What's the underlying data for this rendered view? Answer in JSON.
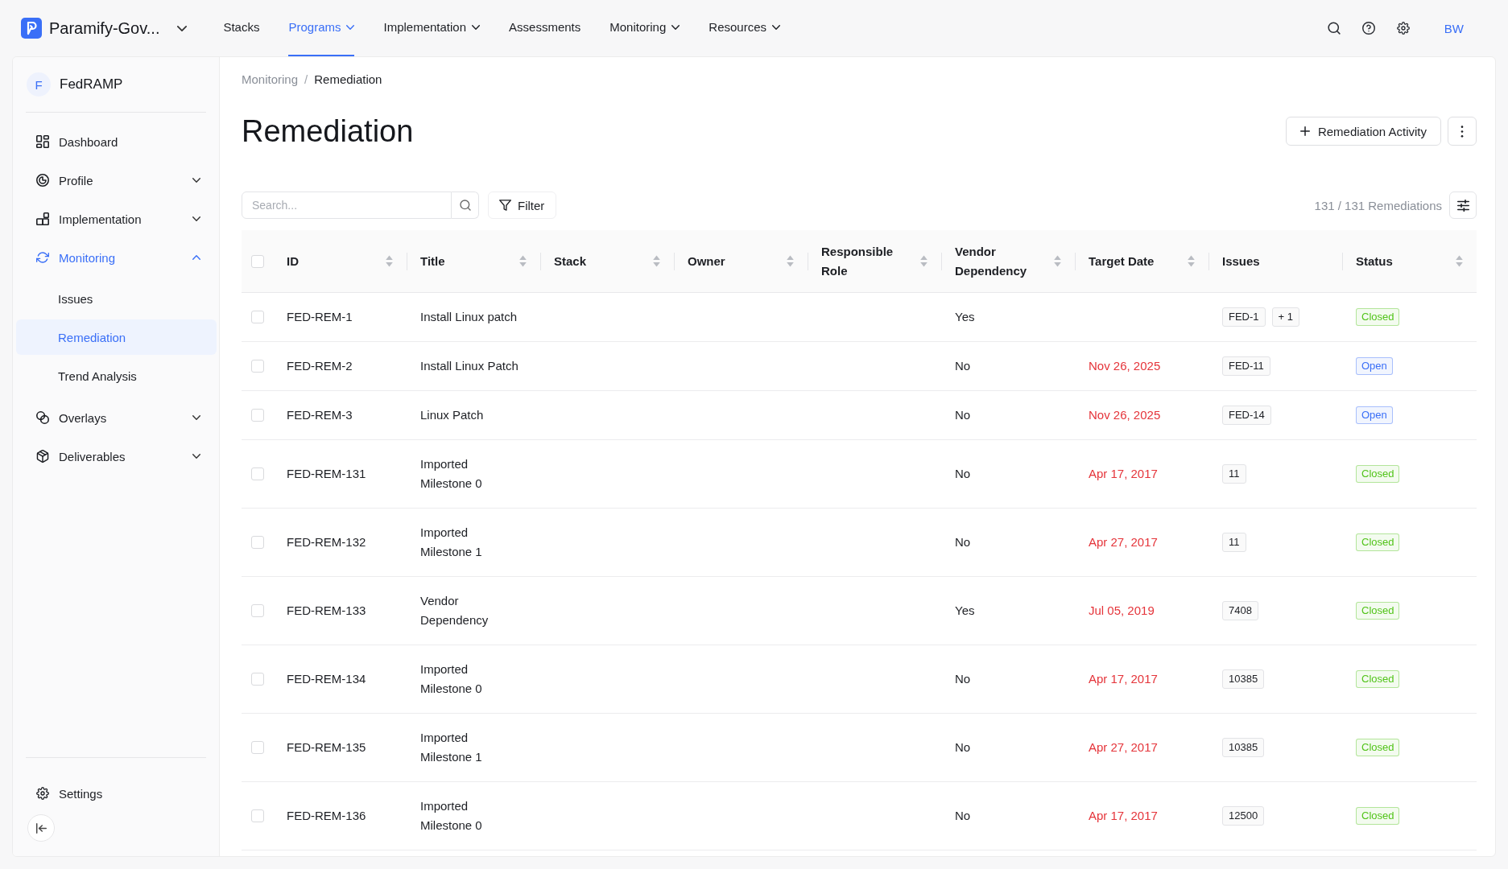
{
  "app": {
    "name": "Paramify-Gov..."
  },
  "nav": [
    {
      "label": "Stacks",
      "selected": false,
      "dropdown": false
    },
    {
      "label": "Programs",
      "selected": true,
      "dropdown": true
    },
    {
      "label": "Implementation",
      "selected": false,
      "dropdown": true
    },
    {
      "label": "Assessments",
      "selected": false,
      "dropdown": false
    },
    {
      "label": "Monitoring",
      "selected": false,
      "dropdown": true
    },
    {
      "label": "Resources",
      "selected": false,
      "dropdown": true
    }
  ],
  "user": {
    "initials": "BW"
  },
  "sidebar": {
    "program": {
      "initial": "F",
      "name": "FedRAMP"
    },
    "items": [
      {
        "label": "Dashboard",
        "kind": "link",
        "selected": false
      },
      {
        "label": "Profile",
        "kind": "group",
        "selected": false,
        "expanded": false
      },
      {
        "label": "Implementation",
        "kind": "group",
        "selected": false,
        "expanded": false
      },
      {
        "label": "Monitoring",
        "kind": "group",
        "selected": true,
        "expanded": true,
        "children": [
          {
            "label": "Issues",
            "selected": false
          },
          {
            "label": "Remediation",
            "selected": true
          },
          {
            "label": "Trend Analysis",
            "selected": false
          }
        ]
      },
      {
        "label": "Overlays",
        "kind": "group",
        "selected": false,
        "expanded": false
      },
      {
        "label": "Deliverables",
        "kind": "group",
        "selected": false,
        "expanded": false
      }
    ],
    "footer": [
      {
        "label": "Settings"
      }
    ]
  },
  "breadcrumb": {
    "items": [
      "Monitoring",
      "Remediation"
    ],
    "separator": "/"
  },
  "page": {
    "title": "Remediation",
    "primary_action": "Remediation Activity"
  },
  "toolbar": {
    "search": {
      "placeholder": "Search..."
    },
    "filter": "Filter",
    "count": "131 / 131 Remediations"
  },
  "table": {
    "select_all": {
      "checked": false
    },
    "columns": [
      {
        "label": "ID",
        "sortable": true
      },
      {
        "label": "Title",
        "sortable": true
      },
      {
        "label": "Stack",
        "sortable": true
      },
      {
        "label": "Owner",
        "sortable": true
      },
      {
        "label": "Responsible Role",
        "sortable": true
      },
      {
        "label": "Vendor Dependency",
        "sortable": true
      },
      {
        "label": "Target Date",
        "sortable": true
      },
      {
        "label": "Issues",
        "sortable": false
      },
      {
        "label": "Status",
        "sortable": true
      }
    ],
    "rows": [
      {
        "selected": false,
        "id": "FED-REM-1",
        "title": "Install Linux patch",
        "vendor_dependency": "Yes",
        "issues": [
          "FED-1"
        ],
        "issues_more": "+ 1",
        "status": {
          "label": "Closed",
          "color": "#52c41a"
        }
      },
      {
        "selected": false,
        "id": "FED-REM-2",
        "title": "Install Linux Patch",
        "vendor_dependency": "No",
        "target_date": "Nov 26, 2025",
        "issues": [
          "FED-11"
        ],
        "status": {
          "label": "Open",
          "color": "#3a6ff7"
        }
      },
      {
        "selected": false,
        "id": "FED-REM-3",
        "title": "Linux Patch",
        "vendor_dependency": "No",
        "target_date": "Nov 26, 2025",
        "issues": [
          "FED-14"
        ],
        "status": {
          "label": "Open",
          "color": "#3a6ff7"
        }
      },
      {
        "selected": false,
        "id": "FED-REM-131",
        "title": "Imported\nMilestone 0",
        "vendor_dependency": "No",
        "target_date": "Apr 17, 2017",
        "issues": [
          "11"
        ],
        "status": {
          "label": "Closed",
          "color": "#52c41a"
        }
      },
      {
        "selected": false,
        "id": "FED-REM-132",
        "title": "Imported\nMilestone 1",
        "vendor_dependency": "No",
        "target_date": "Apr 27, 2017",
        "issues": [
          "11"
        ],
        "status": {
          "label": "Closed",
          "color": "#52c41a"
        }
      },
      {
        "selected": false,
        "id": "FED-REM-133",
        "title": "Vendor\nDependency",
        "vendor_dependency": "Yes",
        "target_date": "Jul 05, 2019",
        "issues": [
          "7408"
        ],
        "status": {
          "label": "Closed",
          "color": "#52c41a"
        }
      },
      {
        "selected": false,
        "id": "FED-REM-134",
        "title": "Imported\nMilestone 0",
        "vendor_dependency": "No",
        "target_date": "Apr 17, 2017",
        "issues": [
          "10385"
        ],
        "status": {
          "label": "Closed",
          "color": "#52c41a"
        }
      },
      {
        "selected": false,
        "id": "FED-REM-135",
        "title": "Imported\nMilestone 1",
        "vendor_dependency": "No",
        "target_date": "Apr 27, 2017",
        "issues": [
          "10385"
        ],
        "status": {
          "label": "Closed",
          "color": "#52c41a"
        }
      },
      {
        "selected": false,
        "id": "FED-REM-136",
        "title": "Imported\nMilestone 0",
        "vendor_dependency": "No",
        "target_date": "Apr 17, 2017",
        "issues": [
          "12500"
        ],
        "status": {
          "label": "Closed",
          "color": "#52c41a"
        }
      }
    ]
  }
}
